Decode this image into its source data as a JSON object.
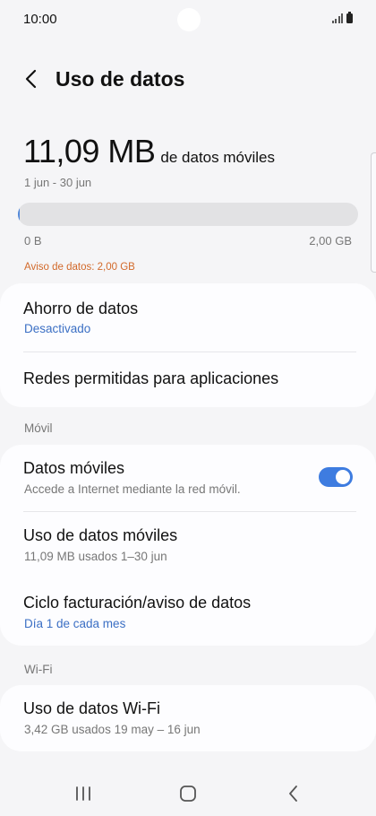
{
  "status_bar": {
    "time": "10:00"
  },
  "header": {
    "title": "Uso de datos"
  },
  "usage": {
    "amount": "11,09 MB",
    "suffix": "de datos móviles",
    "period": "1 jun - 30 jun",
    "bar_fill_fraction": 0.005,
    "axis_min": "0 B",
    "axis_max": "2,00 GB",
    "warning": "Aviso de datos: 2,00 GB"
  },
  "card1": {
    "data_saver": {
      "title": "Ahorro de datos",
      "status": "Desactivado"
    },
    "allowed_networks": {
      "title": "Redes permitidas para aplicaciones"
    }
  },
  "mobile_section": {
    "label": "Móvil",
    "mobile_data": {
      "title": "Datos móviles",
      "subtitle": "Accede a Internet mediante la red móvil.",
      "enabled": true
    },
    "mobile_usage": {
      "title": "Uso de datos móviles",
      "subtitle": "11,09 MB usados 1–30 jun"
    },
    "billing_cycle": {
      "title": "Ciclo facturación/aviso de datos",
      "subtitle": "Día 1 de cada mes"
    }
  },
  "wifi_section": {
    "label": "Wi-Fi",
    "wifi_usage": {
      "title": "Uso de datos Wi-Fi",
      "subtitle": "3,42 GB usados 19 may – 16 jun"
    }
  },
  "colors": {
    "accent": "#3e7ce0",
    "warning": "#d2692a",
    "link": "#3b6fc4"
  },
  "nav_bar": {
    "icons": [
      "recent-apps-icon",
      "home-icon",
      "back-icon"
    ]
  }
}
